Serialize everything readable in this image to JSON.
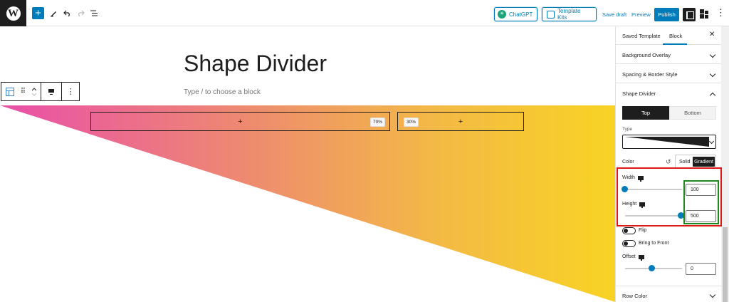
{
  "topbar": {
    "add_label": "+",
    "chatgpt_label": "ChatGPT",
    "template_kits_label": "Template Kits",
    "save_draft_label": "Save draft",
    "preview_label": "Preview",
    "publish_label": "Publish",
    "icons": [
      "wordpress-logo-icon",
      "add-block-icon",
      "pen-icon",
      "undo-icon",
      "redo-icon",
      "list-view-icon",
      "settings-panel-icon",
      "blocks-icon",
      "more-options-icon"
    ]
  },
  "canvas": {
    "title": "Shape Divider",
    "placeholder": "Type / to choose a block",
    "columns": [
      {
        "add": "+",
        "width_label": "70%"
      },
      {
        "add": "+",
        "width_label": "30%"
      }
    ],
    "gradient_colors": [
      "#e94fa9",
      "#ee8a70",
      "#f3b847",
      "#f8d324"
    ]
  },
  "sidebar": {
    "tabs": [
      "Saved Template",
      "Block"
    ],
    "active_tab": "Block",
    "close_label": "✕",
    "panels": {
      "background_overlay": "Background Overlay",
      "spacing_border": "Spacing & Border Style",
      "shape_divider": "Shape Divider",
      "row_color": "Row Color"
    },
    "shape_divider": {
      "position_options": [
        "Top",
        "Bottom"
      ],
      "selected_position": "Top",
      "type_label": "Type",
      "color_label": "Color",
      "color_modes": [
        "Solid",
        "Gradient"
      ],
      "selected_color_mode": "Gradient",
      "width_label": "Width",
      "width_value": "100",
      "height_label": "Height",
      "height_value": "500",
      "flip_label": "Flip",
      "flip_on": false,
      "bring_front_label": "Bring to Front",
      "bring_front_on": false,
      "offset_label": "Offset",
      "offset_value": "0"
    }
  }
}
